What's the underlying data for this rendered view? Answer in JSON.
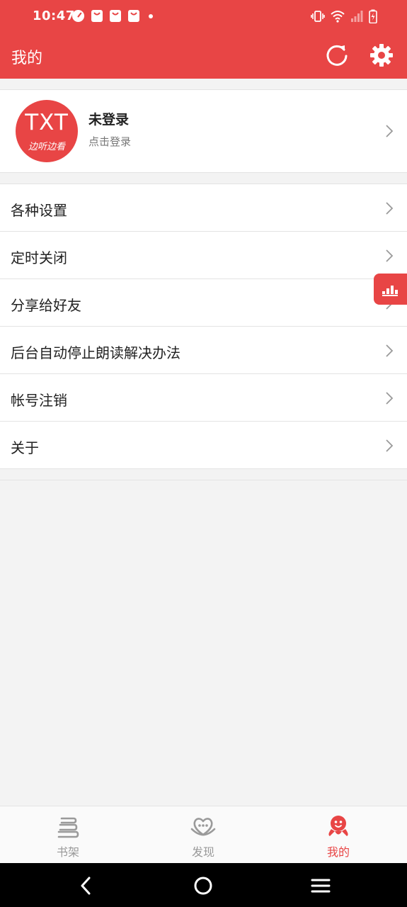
{
  "status_bar": {
    "time": "10:47",
    "left_icons": [
      "speedometer-icon",
      "shopping-bag-icon",
      "shopping-bag-icon",
      "shopping-bag-icon",
      "dot-icon"
    ],
    "right_icons": [
      "vibrate-icon",
      "wifi-icon",
      "signal-icon",
      "battery-charging-icon"
    ]
  },
  "header": {
    "title": "我的",
    "actions": [
      "refresh-icon",
      "settings-gear-icon"
    ]
  },
  "profile": {
    "avatar_logo_main": "TXT",
    "avatar_logo_sub": "边听边看",
    "name": "未登录",
    "hint": "点击登录"
  },
  "menu": {
    "items": [
      {
        "label": "各种设置"
      },
      {
        "label": "定时关闭"
      },
      {
        "label": "分享给好友"
      },
      {
        "label": "后台自动停止朗读解决办法"
      },
      {
        "label": "帐号注销"
      },
      {
        "label": "关于"
      }
    ]
  },
  "tabbar": {
    "tabs": [
      {
        "label": "书架",
        "icon": "bookshelf-icon",
        "active": false
      },
      {
        "label": "发现",
        "icon": "discover-heart-icon",
        "active": false
      },
      {
        "label": "我的",
        "icon": "mine-mascot-icon",
        "active": true
      }
    ]
  },
  "colors": {
    "accent": "#e84545",
    "background": "#f3f3f3",
    "inactive_tab": "#999999"
  }
}
